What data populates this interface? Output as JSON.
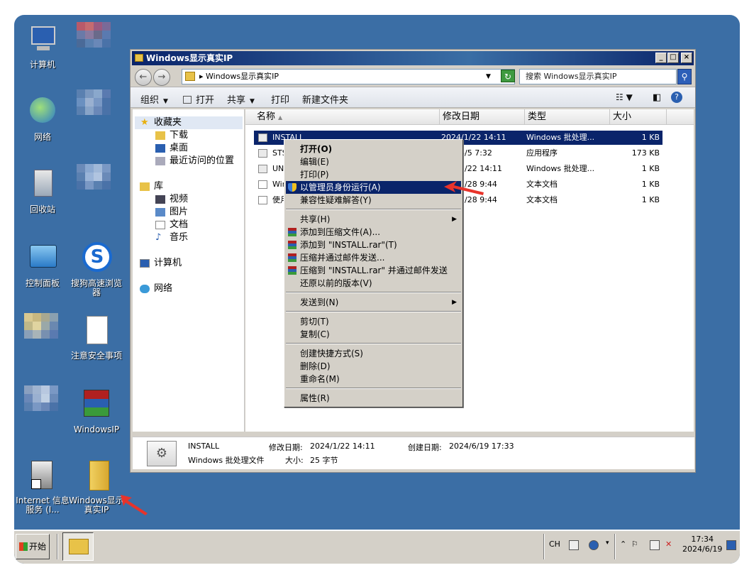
{
  "desktop": {
    "icons": [
      {
        "label": "计算机"
      },
      {
        "label": "网络"
      },
      {
        "label": "回收站"
      },
      {
        "label": "控制面板"
      },
      {
        "label": "搜狗高速浏览器"
      },
      {
        "label": "注意安全事项"
      },
      {
        "label": "WindowsIP"
      },
      {
        "label": "Internet 信息服务 (I..."
      },
      {
        "label": "Windows显示真实IP"
      }
    ]
  },
  "window": {
    "title": "Windows显示真实IP",
    "address": "▸ Windows显示真实IP",
    "search_placeholder": "搜索 Windows显示真实IP",
    "controls": {
      "minimize": "_",
      "maximize": "□",
      "close": "×"
    }
  },
  "toolbar": {
    "organize": "组织",
    "open": "打开",
    "share": "共享",
    "print": "打印",
    "new_folder": "新建文件夹"
  },
  "navpane": {
    "favorites": "收藏夹",
    "downloads": "下载",
    "desktop": "桌面",
    "recent": "最近访问的位置",
    "libraries": "库",
    "videos": "视频",
    "pictures": "图片",
    "documents": "文档",
    "music": "音乐",
    "computer": "计算机",
    "network": "网络"
  },
  "columns": {
    "name": "名称",
    "modified": "修改日期",
    "type": "类型",
    "size": "大小"
  },
  "files": [
    {
      "name": "INSTALL",
      "date": "2024/1/22 14:11",
      "type": "Windows 批处理...",
      "size": "1 KB"
    },
    {
      "name": "STS",
      "date": "6/5 7:32",
      "type": "应用程序",
      "size": "173 KB"
    },
    {
      "name": "UNI",
      "date": "1/22 14:11",
      "type": "Windows 批处理...",
      "size": "1 KB"
    },
    {
      "name": "Wir",
      "date": "5/28 9:44",
      "type": "文本文档",
      "size": "1 KB"
    },
    {
      "name": "使月",
      "date": "5/28 9:44",
      "type": "文本文档",
      "size": "1 KB"
    }
  ],
  "context_menu": {
    "open": "打开(O)",
    "edit": "编辑(E)",
    "print": "打印(P)",
    "run_as_admin": "以管理员身份运行(A)",
    "compat": "兼容性疑难解答(Y)",
    "share": "共享(H)",
    "add_archive": "添加到压缩文件(A)...",
    "add_rar": "添加到 \"INSTALL.rar\"(T)",
    "compress_email": "压缩并通过邮件发送...",
    "compress_rar_email": "压缩到 \"INSTALL.rar\" 并通过邮件发送",
    "restore": "还原以前的版本(V)",
    "send_to": "发送到(N)",
    "cut": "剪切(T)",
    "copy": "复制(C)",
    "shortcut": "创建快捷方式(S)",
    "delete": "删除(D)",
    "rename": "重命名(M)",
    "properties": "属性(R)"
  },
  "details": {
    "name": "INSTALL",
    "modified_label": "修改日期:",
    "modified": "2024/1/22 14:11",
    "created_label": "创建日期:",
    "created": "2024/6/19 17:33",
    "type": "Windows 批处理文件",
    "size_label": "大小:",
    "size": "25 字节"
  },
  "taskbar": {
    "start": "开始",
    "lang": "CH",
    "time": "17:34",
    "date": "2024/6/19"
  },
  "colors": {
    "desktop": "#3b6ea5",
    "selection": "#0a246a",
    "arrow": "#e8332a"
  }
}
